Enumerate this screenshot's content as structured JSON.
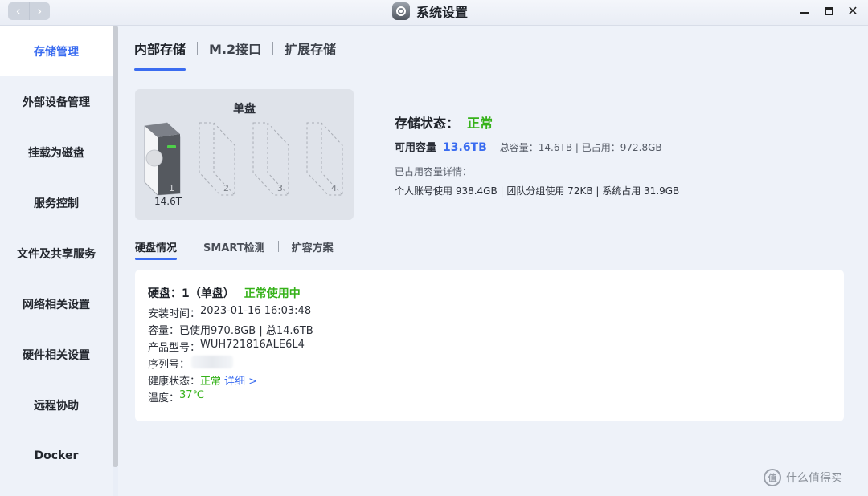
{
  "window": {
    "title": "系统设置",
    "back_glyph": "‹",
    "forward_glyph": "›",
    "close_glyph": "✕"
  },
  "sidebar": {
    "items": [
      {
        "label": "存储管理",
        "active": true
      },
      {
        "label": "外部设备管理"
      },
      {
        "label": "挂载为磁盘"
      },
      {
        "label": "服务控制"
      },
      {
        "label": "文件及共享服务"
      },
      {
        "label": "网络相关设置"
      },
      {
        "label": "硬件相关设置"
      },
      {
        "label": "远程协助"
      },
      {
        "label": "Docker"
      }
    ]
  },
  "tabs": [
    "内部存储",
    "M.2接口",
    "扩展存储"
  ],
  "bay": {
    "title": "单盘",
    "slots": [
      "1",
      "2",
      "3",
      "4"
    ],
    "capacity": "14.6T"
  },
  "storage": {
    "status_label": "存储状态：",
    "status_value": "正常",
    "available_label": "可用容量",
    "available_value": "13.6TB",
    "total_text": "总容量：14.6TB | 已占用：972.8GB",
    "used_title": "已占用容量详情：",
    "used_detail": "个人账号使用 938.4GB | 团队分组使用 72KB | 系统占用 31.9GB"
  },
  "subtabs": [
    "硬盘情况",
    "SMART检测",
    "扩容方案"
  ],
  "disk": {
    "title": "硬盘：1（单盘）",
    "state": "正常使用中",
    "install_label": "安装时间：",
    "install_value": "2023-01-16 16:03:48",
    "capacity_label": "容量：",
    "capacity_value": "已使用970.8GB | 总14.6TB",
    "model_label": "产品型号：",
    "model_value": "WUH721816ALE6L4",
    "serial_label": "序列号：",
    "serial_value": "",
    "health_label": "健康状态：",
    "health_value": "正常",
    "health_link": "详细 >",
    "temp_label": "温度：",
    "temp_value": "37℃"
  },
  "watermark": {
    "icon_text": "值",
    "text": "什么值得买"
  },
  "colors": {
    "accent": "#3a6cf0",
    "ok": "#36b21a"
  }
}
